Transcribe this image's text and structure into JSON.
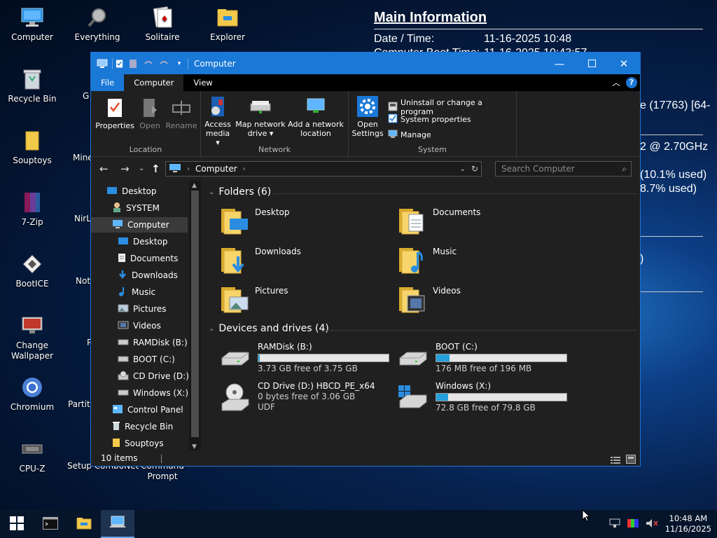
{
  "desktop": {
    "icons_left": [
      {
        "label": "Computer",
        "icon": "computer-icon"
      },
      {
        "label": "Recycle Bin",
        "icon": "recycle-bin-icon"
      },
      {
        "label": "Souptoys",
        "icon": "folder-icon"
      },
      {
        "label": "7-Zip",
        "icon": "7zip-icon"
      },
      {
        "label": "BootICE",
        "icon": "bootice-icon"
      },
      {
        "label": "Change Wallpaper",
        "icon": "wallpaper-icon"
      },
      {
        "label": "Chromium",
        "icon": "chromium-icon"
      },
      {
        "label": "CPU-Z",
        "icon": "cpuz-icon"
      }
    ],
    "icons_top": [
      {
        "label": "Everything",
        "icon": "magnifier-icon"
      },
      {
        "label": "Solitaire",
        "icon": "cards-icon"
      },
      {
        "label": "Explorer",
        "icon": "explorer-icon"
      }
    ],
    "partial_labels": {
      "g": "G",
      "mine": "Mine",
      "nirl": "NirL",
      "not": "Not",
      "p": "P",
      "partiti": "Partiti",
      "setup": "Setup ComboNet",
      "cmd": "Command\nPrompt"
    }
  },
  "info": {
    "title": "Main Information",
    "date_key": "Date / Time:",
    "date_val": "11-16-2025 10:48",
    "boot_key": "Computer Boot Time:",
    "boot_val": "11-16-2025 10:43:57",
    "frag_os": "e (17763) [64-",
    "frag_cpu": "2 @ 2.70GHz",
    "frag_mem1": "(10.1% used)",
    "frag_mem2": "8.7% used)",
    "frag_paren": ")"
  },
  "window": {
    "title": "Computer",
    "tabs": {
      "file": "File",
      "computer": "Computer",
      "view": "View"
    },
    "ribbon": {
      "properties": "Properties",
      "open": "Open",
      "rename": "Rename",
      "location_group": "Location",
      "access_media": "Access media ▾",
      "map_drive": "Map network drive ▾",
      "add_location": "Add a network location",
      "network_group": "Network",
      "open_settings": "Open Settings",
      "uninstall": "Uninstall or change a program",
      "sys_props": "System properties",
      "manage": "Manage",
      "system_group": "System"
    },
    "address": {
      "path": "Computer",
      "search_placeholder": "Search Computer"
    },
    "nav": [
      {
        "label": "Desktop",
        "indent": 0,
        "icon": "desktop-icon"
      },
      {
        "label": "SYSTEM",
        "indent": 1,
        "icon": "user-icon"
      },
      {
        "label": "Computer",
        "indent": 1,
        "icon": "computer-icon",
        "selected": true
      },
      {
        "label": "Desktop",
        "indent": 2,
        "icon": "desktop-icon"
      },
      {
        "label": "Documents",
        "indent": 2,
        "icon": "documents-icon"
      },
      {
        "label": "Downloads",
        "indent": 2,
        "icon": "downloads-icon"
      },
      {
        "label": "Music",
        "indent": 2,
        "icon": "music-icon"
      },
      {
        "label": "Pictures",
        "indent": 2,
        "icon": "pictures-icon"
      },
      {
        "label": "Videos",
        "indent": 2,
        "icon": "videos-icon"
      },
      {
        "label": "RAMDisk (B:)",
        "indent": 2,
        "icon": "drive-icon"
      },
      {
        "label": "BOOT (C:)",
        "indent": 2,
        "icon": "drive-icon"
      },
      {
        "label": "CD Drive (D:) H",
        "indent": 2,
        "icon": "cd-drive-icon"
      },
      {
        "label": "Windows (X:)",
        "indent": 2,
        "icon": "drive-icon"
      },
      {
        "label": "Control Panel",
        "indent": 1,
        "icon": "control-panel-icon"
      },
      {
        "label": "Recycle Bin",
        "indent": 1,
        "icon": "recycle-bin-icon"
      },
      {
        "label": "Souptoys",
        "indent": 1,
        "icon": "folder-icon"
      }
    ],
    "folders_header": "Folders (6)",
    "folders": [
      {
        "label": "Desktop",
        "icon": "desktop-folder-icon"
      },
      {
        "label": "Documents",
        "icon": "documents-folder-icon"
      },
      {
        "label": "Downloads",
        "icon": "downloads-folder-icon"
      },
      {
        "label": "Music",
        "icon": "music-folder-icon"
      },
      {
        "label": "Pictures",
        "icon": "pictures-folder-icon"
      },
      {
        "label": "Videos",
        "icon": "videos-folder-icon"
      }
    ],
    "drives_header": "Devices and drives (4)",
    "drives": [
      {
        "name": "RAMDisk (B:)",
        "free": "3.73 GB free of 3.75 GB",
        "used_fraction": 0.005,
        "icon": "hdd-icon"
      },
      {
        "name": "BOOT (C:)",
        "free": "176 MB free of 196 MB",
        "used_fraction": 0.1,
        "icon": "hdd-icon"
      },
      {
        "name": "CD Drive (D:) HBCD_PE_x64",
        "free": "0 bytes free of 3.06 GB",
        "fs": "UDF",
        "icon": "cd-drive-icon"
      },
      {
        "name": "Windows (X:)",
        "free": "72.8 GB free of 79.8 GB",
        "used_fraction": 0.09,
        "icon": "windows-drive-icon"
      }
    ],
    "status": "10 items"
  },
  "taskbar": {
    "time": "10:48 AM",
    "date": "11/16/2025"
  },
  "colors": {
    "accent": "#1a78d7",
    "window_bg": "#202020",
    "bar_fill": "#26a0da"
  }
}
